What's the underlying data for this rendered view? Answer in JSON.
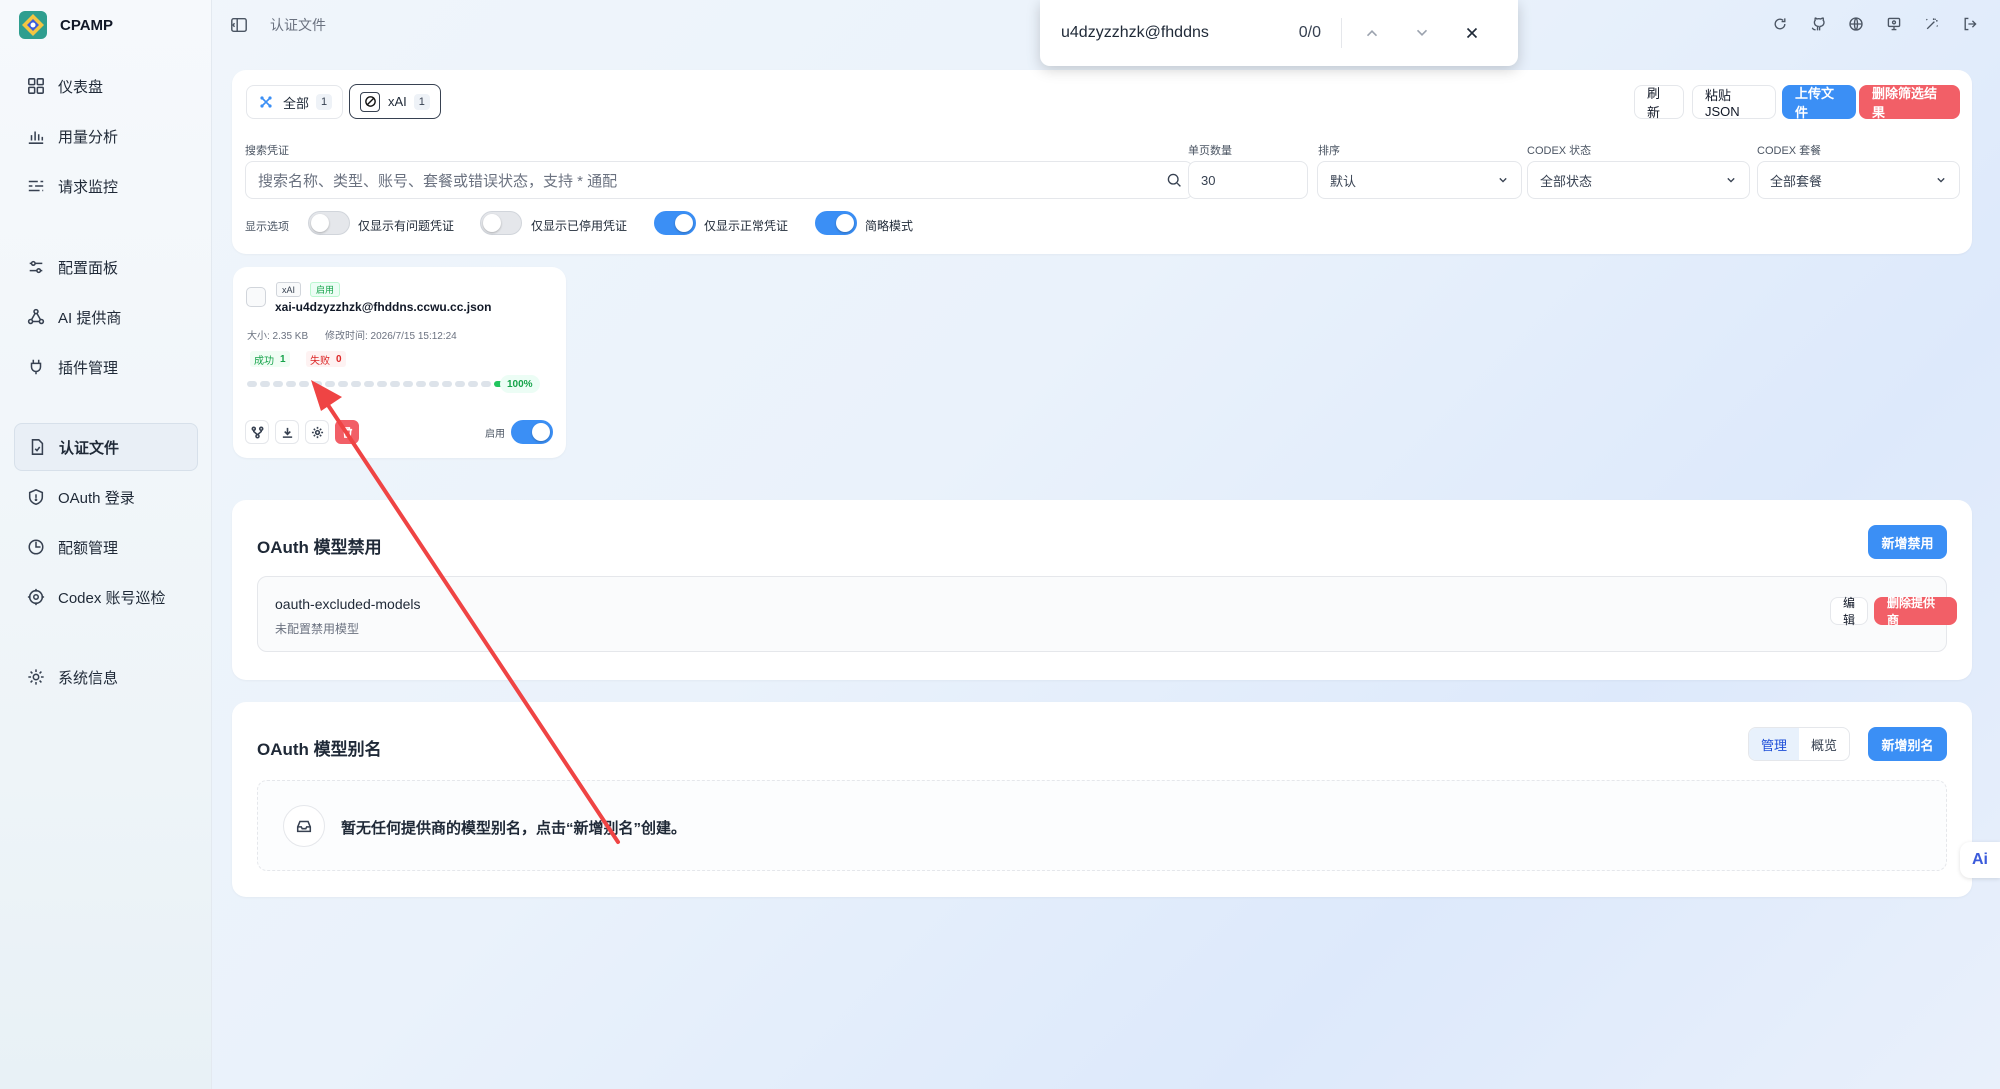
{
  "app": {
    "name": "CPAMP"
  },
  "topbar": {
    "crumb": "认证文件"
  },
  "find_bar": {
    "query": "u4dzyzzhzk@fhddns",
    "count": "0/0"
  },
  "sidebar": {
    "items": [
      {
        "label": "仪表盘",
        "icon": "dashboard-icon"
      },
      {
        "label": "用量分析",
        "icon": "bar-chart-icon"
      },
      {
        "label": "请求监控",
        "icon": "monitor-icon"
      },
      {
        "label": "配置面板",
        "icon": "sliders-icon"
      },
      {
        "label": "AI 提供商",
        "icon": "provider-icon"
      },
      {
        "label": "插件管理",
        "icon": "plug-icon"
      },
      {
        "label": "认证文件",
        "icon": "file-check-icon",
        "active": true
      },
      {
        "label": "OAuth 登录",
        "icon": "shield-icon"
      },
      {
        "label": "配额管理",
        "icon": "pie-icon"
      },
      {
        "label": "Codex 账号巡检",
        "icon": "target-icon"
      },
      {
        "label": "系统信息",
        "icon": "gear-icon"
      }
    ]
  },
  "filters": {
    "chips": [
      {
        "label": "全部",
        "count": "1"
      },
      {
        "label": "xAI",
        "count": "1"
      }
    ],
    "actions": {
      "refresh": "刷新",
      "paste_json": "粘贴 JSON",
      "upload": "上传文件",
      "delete_filtered": "删除筛选结果"
    },
    "search": {
      "label": "搜索凭证",
      "placeholder": "搜索名称、类型、账号、套餐或错误状态，支持 * 通配"
    },
    "page_size": {
      "label": "单页数量",
      "value": "30"
    },
    "sort": {
      "label": "排序",
      "value": "默认"
    },
    "codex_status": {
      "label": "CODEX 状态",
      "value": "全部状态"
    },
    "codex_plan": {
      "label": "CODEX 套餐",
      "value": "全部套餐"
    },
    "display": {
      "label": "显示选项",
      "toggles": [
        {
          "label": "仅显示有问题凭证",
          "on": false
        },
        {
          "label": "仅显示已停用凭证",
          "on": false
        },
        {
          "label": "仅显示正常凭证",
          "on": true
        },
        {
          "label": "简略模式",
          "on": true
        }
      ]
    }
  },
  "credential": {
    "provider_tag": "xAI",
    "status_tag": "启用",
    "name": "xai-u4dzyzzhzk@fhddns.ccwu.cc.json",
    "size": "大小: 2.35 KB",
    "modified": "修改时间: 2026/7/15 15:12:24",
    "success_label": "成功",
    "success_count": "1",
    "fail_label": "失败",
    "fail_count": "0",
    "health_percent": "100%",
    "health_fraction": 1.0,
    "enable_label": "启用",
    "enabled": true
  },
  "oauth_excluded": {
    "title": "OAuth 模型禁用",
    "add_button": "新增禁用",
    "item_name": "oauth-excluded-models",
    "item_desc": "未配置禁用模型",
    "edit_button": "编辑",
    "delete_button": "删除提供商"
  },
  "oauth_alias": {
    "title": "OAuth 模型别名",
    "tabs": [
      "管理",
      "概览"
    ],
    "add_button": "新增别名",
    "empty_text": "暂无任何提供商的模型别名，点击“新增别名”创建。"
  },
  "floating": {
    "ai_label": "Ai"
  },
  "colors": {
    "primary": "#3b8ff5",
    "danger": "#f25f67",
    "success": "#22c55e",
    "annotation": "#ef4444"
  }
}
